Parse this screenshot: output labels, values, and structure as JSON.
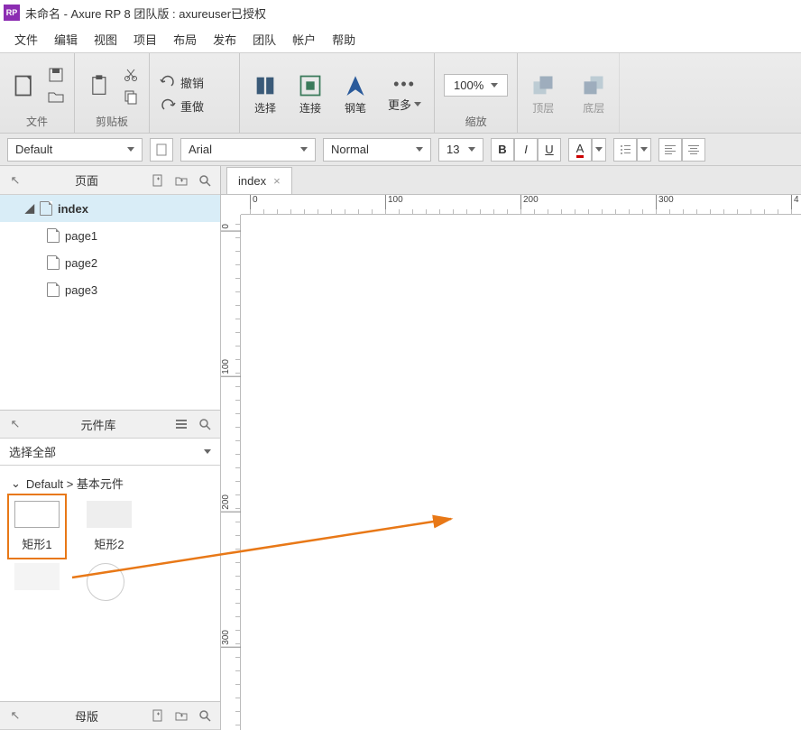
{
  "title": "未命名 - Axure RP 8 团队版 : axureuser已授权",
  "menu": [
    "文件",
    "编辑",
    "视图",
    "项目",
    "布局",
    "发布",
    "团队",
    "帐户",
    "帮助"
  ],
  "ribbon": {
    "file": "文件",
    "clipboard": "剪贴板",
    "undo": "撤销",
    "redo": "重做",
    "select": "选择",
    "connect": "连接",
    "pen": "钢笔",
    "more": "更多",
    "zoom_value": "100%",
    "zoom_label": "缩放",
    "top": "顶层",
    "bottom": "底层"
  },
  "format": {
    "style": "Default",
    "font": "Arial",
    "weight": "Normal",
    "size": "13"
  },
  "pages_panel": {
    "title": "页面",
    "items": [
      {
        "label": "index",
        "sel": true,
        "depth": 1
      },
      {
        "label": "page1",
        "sel": false,
        "depth": 2
      },
      {
        "label": "page2",
        "sel": false,
        "depth": 2
      },
      {
        "label": "page3",
        "sel": false,
        "depth": 2
      }
    ]
  },
  "library_panel": {
    "title": "元件库",
    "select_all": "选择全部",
    "category": "Default > 基本元件",
    "items": [
      "矩形1",
      "矩形2"
    ]
  },
  "master_panel": {
    "title": "母版"
  },
  "tab": {
    "label": "index"
  },
  "ruler_h": [
    "0",
    "100",
    "200",
    "300",
    "4"
  ],
  "ruler_v": [
    "0",
    "100",
    "200",
    "300"
  ]
}
